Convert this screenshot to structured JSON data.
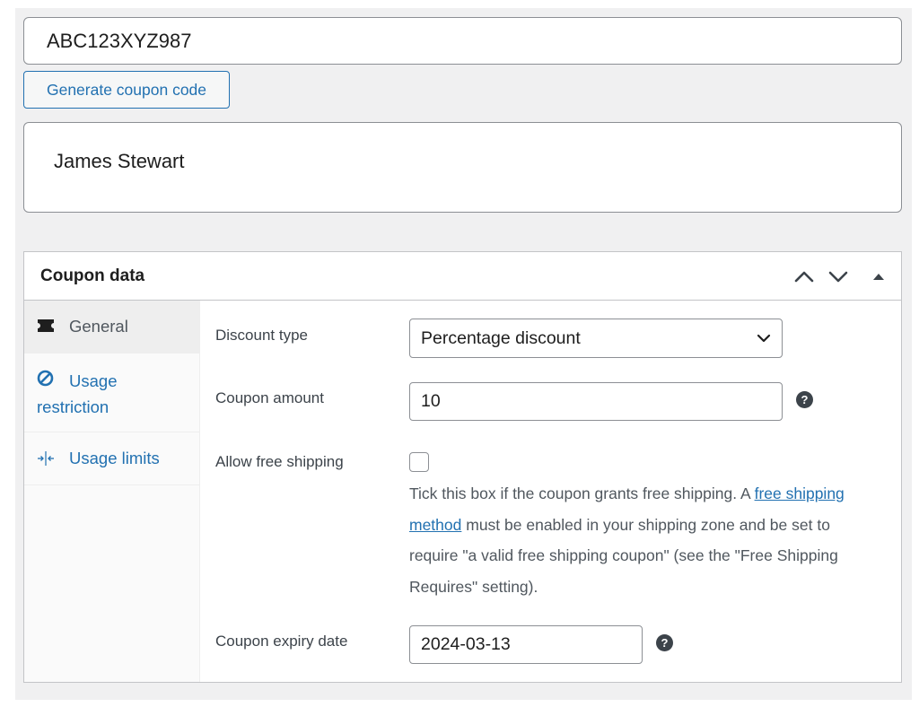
{
  "coupon": {
    "code": "ABC123XYZ987",
    "generate_label": "Generate coupon code",
    "description": "James Stewart"
  },
  "panel": {
    "title": "Coupon data",
    "tabs": [
      {
        "icon": "ticket-icon",
        "label": "General"
      },
      {
        "icon": "restriction-icon",
        "label": "Usage restriction"
      },
      {
        "icon": "limits-icon",
        "label": "Usage limits"
      }
    ],
    "fields": {
      "discount_type": {
        "label": "Discount type",
        "value": "Percentage discount"
      },
      "amount": {
        "label": "Coupon amount",
        "value": "10"
      },
      "free_shipping": {
        "label": "Allow free shipping",
        "desc_before": "Tick this box if the coupon grants free shipping. A ",
        "link_text": "free shipping method",
        "desc_after": " must be enabled in your shipping zone and be set to require \"a valid free shipping coupon\" (see the \"Free Shipping Requires\" setting)."
      },
      "expiry": {
        "label": "Coupon expiry date",
        "value": "2024-03-13"
      }
    },
    "help_glyph": "?"
  },
  "colors": {
    "accent": "#2271b1",
    "border": "#8c8f94",
    "backdrop": "#f0f0f1"
  }
}
